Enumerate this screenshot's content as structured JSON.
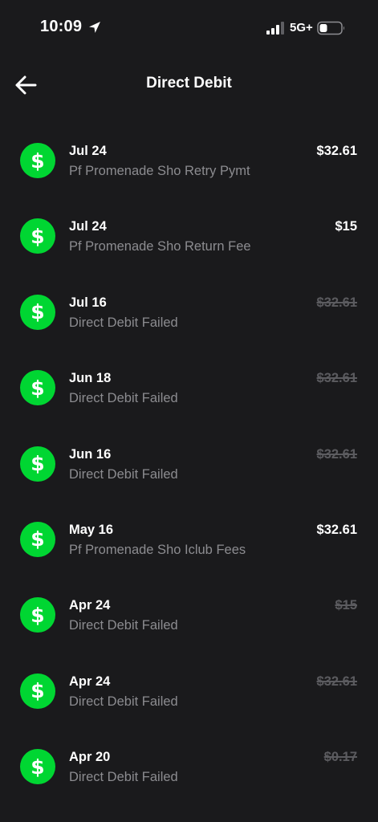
{
  "status_bar": {
    "time": "10:09",
    "network": "5G+"
  },
  "header": {
    "title": "Direct Debit"
  },
  "colors": {
    "background": "#1a1a1c",
    "accent_green": "#00d632",
    "muted_text": "#8c8c90",
    "failed_amount": "#5b5b5f"
  },
  "icons": {
    "back": "arrow-left-icon",
    "row": "dollar-sign-icon",
    "location": "location-arrow-icon",
    "signal": "cellular-signal-icon",
    "battery": "battery-icon"
  },
  "transactions": [
    {
      "date": "Jul 24",
      "description": "Pf Promenade Sho Retry Pymt",
      "amount": "$32.61",
      "failed": false
    },
    {
      "date": "Jul 24",
      "description": "Pf Promenade Sho Return Fee",
      "amount": "$15",
      "failed": false
    },
    {
      "date": "Jul 16",
      "description": "Direct Debit Failed",
      "amount": "$32.61",
      "failed": true
    },
    {
      "date": "Jun 18",
      "description": "Direct Debit Failed",
      "amount": "$32.61",
      "failed": true
    },
    {
      "date": "Jun 16",
      "description": "Direct Debit Failed",
      "amount": "$32.61",
      "failed": true
    },
    {
      "date": "May 16",
      "description": "Pf Promenade Sho Iclub Fees",
      "amount": "$32.61",
      "failed": false
    },
    {
      "date": "Apr 24",
      "description": "Direct Debit Failed",
      "amount": "$15",
      "failed": true
    },
    {
      "date": "Apr 24",
      "description": "Direct Debit Failed",
      "amount": "$32.61",
      "failed": true
    },
    {
      "date": "Apr 20",
      "description": "Direct Debit Failed",
      "amount": "$0.17",
      "failed": true
    }
  ]
}
